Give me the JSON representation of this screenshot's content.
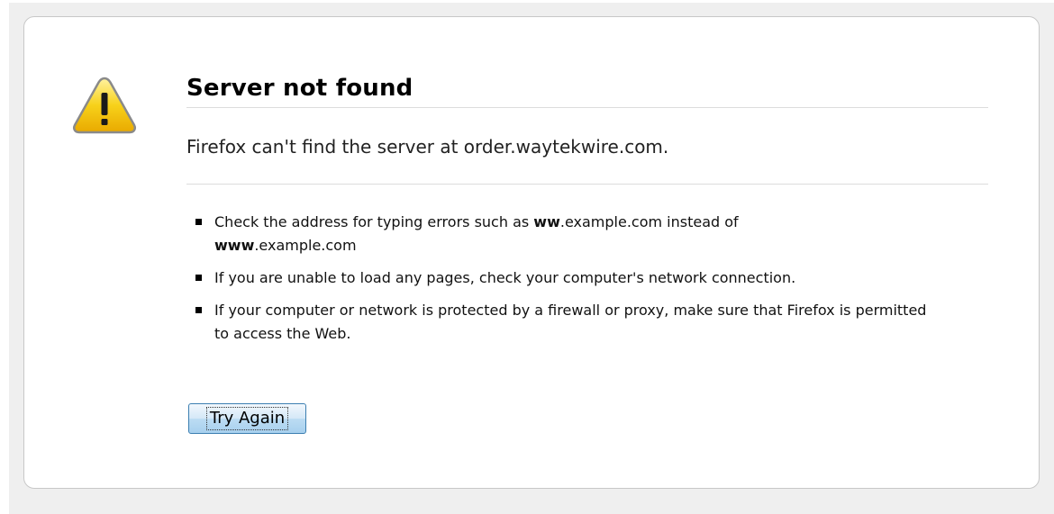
{
  "error": {
    "title": "Server not found",
    "short_desc": "Firefox can't find the server at order.waytekwire.com.",
    "tips": [
      {
        "before": "Check the address for typing errors such as ",
        "bold1": "ww",
        "middle": ".example.com instead of ",
        "bold2": "www",
        "after": ".example.com"
      },
      {
        "text": "If you are unable to load any pages, check your computer's network connection."
      },
      {
        "text": "If your computer or network is protected by a firewall or proxy, make sure that Firefox is permitted to access the Web."
      }
    ],
    "try_again_label": "Try Again"
  },
  "icons": {
    "warning": "warning-triangle-icon"
  },
  "colors": {
    "warning_fill": "#f5c400",
    "button_border": "#3c7fb1",
    "card_border": "#c8c8c8"
  }
}
